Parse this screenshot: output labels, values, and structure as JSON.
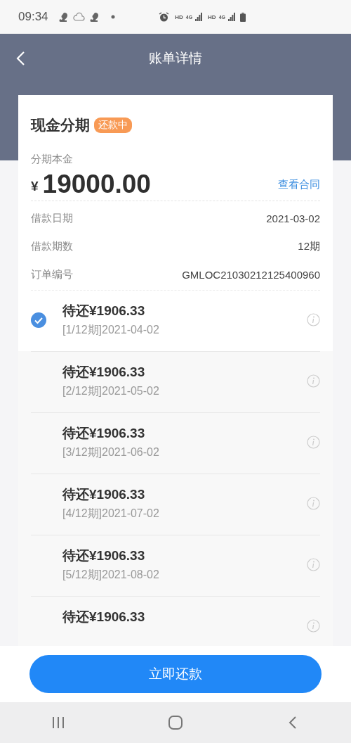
{
  "status_bar": {
    "time": "09:34",
    "network": [
      {
        "label": "HD",
        "tech": "4G"
      },
      {
        "label": "HD",
        "tech": "4G"
      }
    ]
  },
  "header": {
    "title": "账单详情"
  },
  "loan": {
    "title": "现金分期",
    "status": "还款中",
    "principal_label": "分期本金",
    "currency": "¥",
    "amount": "19000.00",
    "contract_link": "查看合同",
    "details": [
      {
        "label": "借款日期",
        "value": "2021-03-02"
      },
      {
        "label": "借款期数",
        "value": "12期"
      },
      {
        "label": "订单编号",
        "value": "GMLOC21030212125400960"
      }
    ]
  },
  "installments": [
    {
      "amount": "待还¥1906.33",
      "period": "[1/12期]2021-04-02",
      "selected": true
    },
    {
      "amount": "待还¥1906.33",
      "period": "[2/12期]2021-05-02",
      "selected": false
    },
    {
      "amount": "待还¥1906.33",
      "period": "[3/12期]2021-06-02",
      "selected": false
    },
    {
      "amount": "待还¥1906.33",
      "period": "[4/12期]2021-07-02",
      "selected": false
    },
    {
      "amount": "待还¥1906.33",
      "period": "[5/12期]2021-08-02",
      "selected": false
    },
    {
      "amount": "待还¥1906.33",
      "selected": false
    }
  ],
  "pay_button": "立即还款"
}
